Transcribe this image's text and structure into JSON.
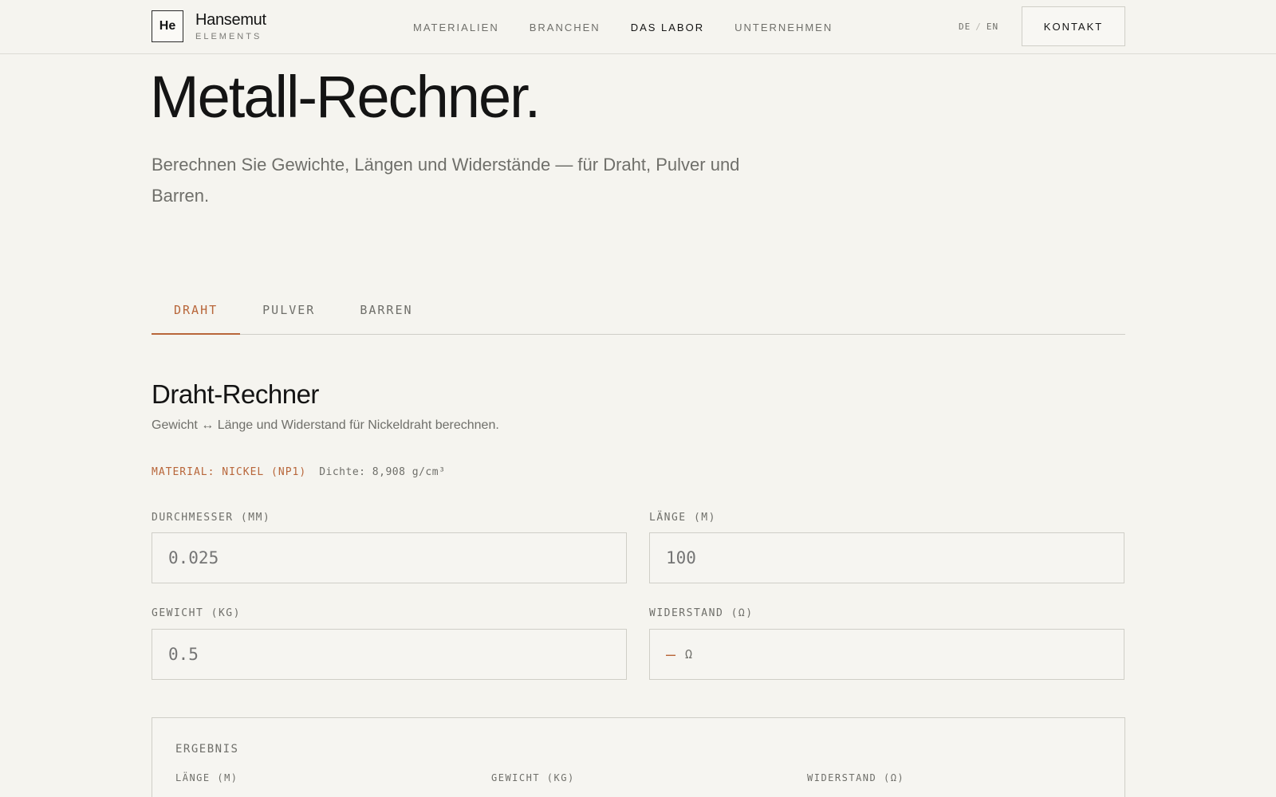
{
  "header": {
    "logo_symbol": "He",
    "logo_name": "Hansemut",
    "logo_sub": "ELEMENTS",
    "nav": [
      {
        "label": "MATERIALIEN"
      },
      {
        "label": "BRANCHEN"
      },
      {
        "label": "DAS LABOR",
        "active": true
      },
      {
        "label": "UNTERNEHMEN"
      }
    ],
    "lang_de": "DE",
    "lang_sep": "/",
    "lang_en": "EN",
    "contact_label": "KONTAKT"
  },
  "hero": {
    "title": "Metall-Rechner.",
    "lead": "Berechnen Sie Gewichte, Längen und Widerstände — für Draht, Pulver und Barren."
  },
  "tabs": [
    {
      "label": "DRAHT",
      "active": true
    },
    {
      "label": "PULVER"
    },
    {
      "label": "BARREN"
    }
  ],
  "calculator": {
    "title": "Draht-Rechner",
    "subtitle": "Gewicht ↔ Länge und Widerstand für Nickeldraht berechnen.",
    "material": "MATERIAL: NICKEL (NP1)",
    "density": "Dichte: 8,908 g/cm³",
    "fields": {
      "diameter": {
        "label": "DURCHMESSER (MM)",
        "placeholder": "0.025"
      },
      "length": {
        "label": "LÄNGE (M)",
        "placeholder": "100"
      },
      "weight": {
        "label": "GEWICHT (KG)",
        "placeholder": "0.5"
      },
      "resistance": {
        "label": "WIDERSTAND (Ω)",
        "dash": "—",
        "unit": "Ω"
      }
    }
  },
  "result": {
    "title": "ERGEBNIS",
    "col_length": "LÄNGE (M)",
    "col_weight": "GEWICHT (KG)",
    "col_resistance": "WIDERSTAND (Ω)"
  },
  "colors": {
    "accent": "#b8663a",
    "background": "#f5f4ef",
    "text": "#141414",
    "muted": "#6f6f6a"
  }
}
